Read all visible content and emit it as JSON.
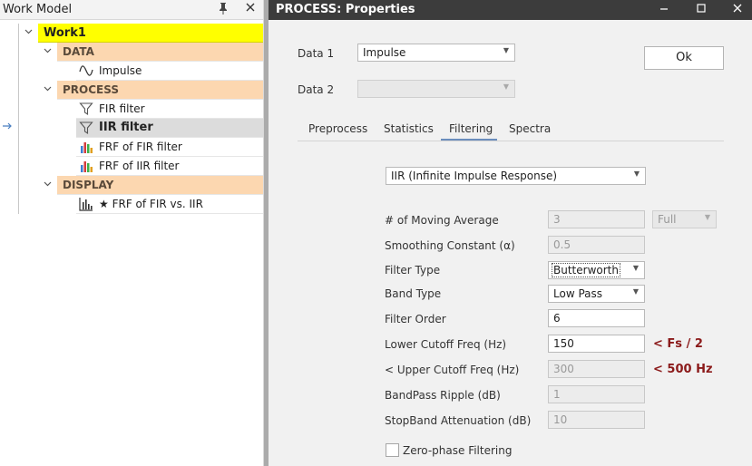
{
  "work_model": {
    "title": "Work Model",
    "pin_icon": "pin-icon",
    "close_icon": "close-icon",
    "root": "Work1",
    "groups": {
      "data": {
        "label": "DATA",
        "items": [
          {
            "label": "Impulse",
            "icon": "waveform-icon"
          }
        ]
      },
      "process": {
        "label": "PROCESS",
        "items": [
          {
            "label": "FIR filter",
            "icon": "filter-icon"
          },
          {
            "label": "IIR filter",
            "icon": "filter-icon"
          },
          {
            "label": "FRF of FIR filter",
            "icon": "bar-chart-color-icon"
          },
          {
            "label": "FRF of IIR filter",
            "icon": "bar-chart-color-icon"
          }
        ]
      },
      "display": {
        "label": "DISPLAY",
        "items": [
          {
            "label": "★ FRF of FIR vs. IIR",
            "icon": "bar-chart-mono-icon"
          }
        ]
      }
    }
  },
  "dialog": {
    "title": "PROCESS: Properties",
    "data1": {
      "label": "Data 1",
      "value": "Impulse"
    },
    "data2": {
      "label": "Data 2",
      "value": ""
    },
    "ok_label": "Ok",
    "tabs": [
      "Preprocess",
      "Statistics",
      "Filtering",
      "Spectra"
    ],
    "active_tab": "Filtering",
    "method": "IIR (Infinite Impulse Response)",
    "moving_average": {
      "label": "# of Moving Average",
      "value": "3",
      "option": "Full"
    },
    "smoothing": {
      "label": "Smoothing Constant (α)",
      "value": "0.5"
    },
    "filter_type": {
      "label": "Filter Type",
      "value": "Butterworth"
    },
    "band_type": {
      "label": "Band Type",
      "value": "Low Pass"
    },
    "filter_order": {
      "label": "Filter Order",
      "value": "6"
    },
    "lower_cutoff": {
      "label": "Lower Cutoff Freq (Hz)",
      "value": "150",
      "hint": "< Fs / 2"
    },
    "upper_cutoff": {
      "label": "< Upper Cutoff Freq (Hz)",
      "value": "300",
      "hint": "< 500 Hz"
    },
    "bandpass_ripple": {
      "label": "BandPass Ripple (dB)",
      "value": "1"
    },
    "stopband_attenuation": {
      "label": "StopBand Attenuation (dB)",
      "value": "10"
    },
    "zero_phase": {
      "label": "Zero-phase Filtering",
      "checked": false
    }
  },
  "colors": {
    "root_highlight": "#ffff00",
    "group_header": "#fcd7b0",
    "titlebar": "#3c3c3c",
    "hint": "#8b1a1a",
    "tab_underline": "#6a8dbd"
  }
}
